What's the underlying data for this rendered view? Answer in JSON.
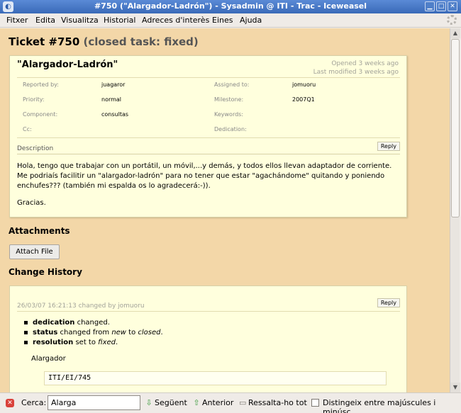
{
  "window": {
    "title": "#750 (\"Alargador-Ladrón\") - Sysadmin @ ITI - Trac - Iceweasel",
    "app_icon": "iceweasel-icon",
    "min_glyph": "▁",
    "max_glyph": "□",
    "close_glyph": "✕"
  },
  "menu": {
    "items": [
      "Fitxer",
      "Edita",
      "Visualitza",
      "Historial",
      "Adreces d'interès",
      "Eines",
      "Ajuda"
    ]
  },
  "ticket": {
    "number": "Ticket #750",
    "status": "(closed task: fixed)",
    "summary": "\"Alargador-Ladrón\"",
    "opened": "Opened 3 weeks ago",
    "modified": "Last modified 3 weeks ago",
    "props": {
      "reported_by_label": "Reported by:",
      "reported_by": "juagaror",
      "assigned_to_label": "Assigned to:",
      "assigned_to": "jomuoru",
      "priority_label": "Priority:",
      "priority": "normal",
      "milestone_label": "Milestone:",
      "milestone": "2007Q1",
      "component_label": "Component:",
      "component": "consultas",
      "keywords_label": "Keywords:",
      "keywords": "",
      "cc_label": "Cc:",
      "cc": "",
      "dedication_label": "Dedication:",
      "dedication": ""
    },
    "description_label": "Description",
    "reply_label": "Reply",
    "description_p1": "Hola, tengo que trabajar con un portátil, un móvil,...y demás, y todos ellos llevan adaptador de corriente. Me podriaís facilitir un \"alargador-ladrón\" para no tener que estar \"agachándome\" quitando y poniendo enchufes??? (también mi espalda os lo agradecerá:-)).",
    "description_p2": "Gracias."
  },
  "attachments": {
    "heading": "Attachments",
    "attach_button": "Attach File"
  },
  "history": {
    "heading": "Change History",
    "entry_meta": "26/03/07 16:21:13 changed by jomuoru",
    "reply_label": "Reply",
    "changes": [
      {
        "field": "dedication",
        "text": " changed."
      },
      {
        "field": "status",
        "text_a": " changed from ",
        "from": "new",
        "text_b": " to ",
        "to": "closed",
        "text_c": "."
      },
      {
        "field": "resolution",
        "text_a": " set to ",
        "to": "fixed",
        "text_c": "."
      }
    ],
    "comment": "Alargador",
    "code": "ITI/EI/745"
  },
  "findbar": {
    "label": "Cerca:",
    "value": "Alarga",
    "next": "Següent",
    "previous": "Anterior",
    "highlight": "Ressalta-ho tot",
    "match_case": "Distingeix entre majúscules i minúsc"
  }
}
